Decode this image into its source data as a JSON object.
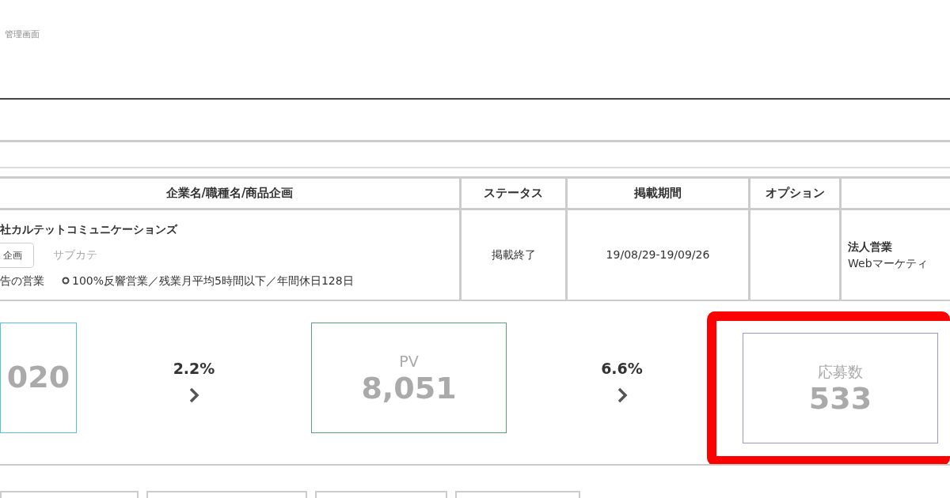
{
  "header": {
    "title": "管理画面"
  },
  "table": {
    "columns": [
      "企業名/職種名/商品企画",
      "ステータス",
      "掲載期間",
      "オプション"
    ],
    "rows": [
      {
        "company": "社カルテットコミュニケーションズ",
        "category": "企画",
        "subcategory": "サブカテ",
        "job": "告の営業",
        "feature": "100%反響営業／残業月平均5時間以下／年間休日128日",
        "status": "掲載終了",
        "period": "19/08/29-19/09/26",
        "job_type": "法人営業",
        "job_detail": "Webマーケティ"
      }
    ]
  },
  "metrics": [
    {
      "kind": "box",
      "value": "020",
      "color": "#5bc0d8",
      "highlighted": false
    },
    {
      "kind": "rate",
      "value": "2.2%"
    },
    {
      "kind": "box",
      "label": "PV",
      "value": "8,051",
      "color": "#5a9e7c",
      "highlighted": false
    },
    {
      "kind": "rate",
      "value": "6.6%"
    },
    {
      "kind": "box",
      "label": "応募数",
      "value": "533",
      "color": "#9a98cc",
      "highlighted": true
    }
  ]
}
